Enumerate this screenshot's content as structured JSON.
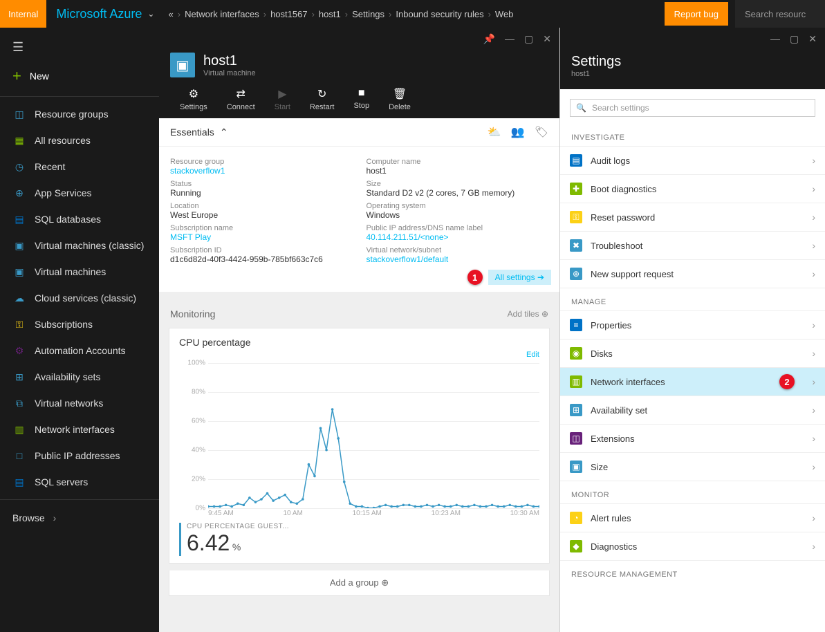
{
  "topbar": {
    "badge": "Internal",
    "brand": "Microsoft Azure",
    "breadcrumbs": [
      "«",
      "Network interfaces",
      "host1567",
      "host1",
      "Settings",
      "Inbound security rules",
      "Web"
    ],
    "report": "Report bug",
    "search_placeholder": "Search resourc"
  },
  "sidebar": {
    "new": "New",
    "items": [
      {
        "icon": "◫",
        "color": "#3999c6",
        "label": "Resource groups"
      },
      {
        "icon": "▦",
        "color": "#7fba00",
        "label": "All resources"
      },
      {
        "icon": "◷",
        "color": "#3999c6",
        "label": "Recent"
      },
      {
        "icon": "⊕",
        "color": "#3999c6",
        "label": "App Services"
      },
      {
        "icon": "▤",
        "color": "#0072c6",
        "label": "SQL databases"
      },
      {
        "icon": "▣",
        "color": "#3999c6",
        "label": "Virtual machines (classic)"
      },
      {
        "icon": "▣",
        "color": "#3999c6",
        "label": "Virtual machines"
      },
      {
        "icon": "☁",
        "color": "#3999c6",
        "label": "Cloud services (classic)"
      },
      {
        "icon": "⚿",
        "color": "#fcd116",
        "label": "Subscriptions"
      },
      {
        "icon": "⚙",
        "color": "#68217a",
        "label": "Automation Accounts"
      },
      {
        "icon": "⊞",
        "color": "#3999c6",
        "label": "Availability sets"
      },
      {
        "icon": "⧉",
        "color": "#3999c6",
        "label": "Virtual networks"
      },
      {
        "icon": "▥",
        "color": "#7fba00",
        "label": "Network interfaces"
      },
      {
        "icon": "□",
        "color": "#3999c6",
        "label": "Public IP addresses"
      },
      {
        "icon": "▤",
        "color": "#0072c6",
        "label": "SQL servers"
      }
    ],
    "browse": "Browse"
  },
  "vm": {
    "title": "host1",
    "subtitle": "Virtual machine",
    "toolbar": [
      {
        "icon": "⚙",
        "label": "Settings"
      },
      {
        "icon": "⇄",
        "label": "Connect"
      },
      {
        "icon": "▶",
        "label": "Start",
        "disabled": true
      },
      {
        "icon": "↻",
        "label": "Restart"
      },
      {
        "icon": "■",
        "label": "Stop"
      },
      {
        "icon": "🗑",
        "label": "Delete"
      }
    ],
    "essentials_title": "Essentials",
    "ess_left": [
      {
        "label": "Resource group",
        "value": "stackoverflow1",
        "link": true
      },
      {
        "label": "Status",
        "value": "Running"
      },
      {
        "label": "Location",
        "value": "West Europe"
      },
      {
        "label": "Subscription name",
        "value": "MSFT Play",
        "link": true
      },
      {
        "label": "Subscription ID",
        "value": "d1c6d82d-40f3-4424-959b-785bf663c7c6"
      }
    ],
    "ess_right": [
      {
        "label": "Computer name",
        "value": "host1"
      },
      {
        "label": "Size",
        "value": "Standard D2 v2 (2 cores, 7 GB memory)"
      },
      {
        "label": "Operating system",
        "value": "Windows"
      },
      {
        "label": "Public IP address/DNS name label",
        "value": "40.114.211.51/<none>",
        "link": true
      },
      {
        "label": "Virtual network/subnet",
        "value": "stackoverflow1/default",
        "link": true
      }
    ],
    "all_settings": "All settings",
    "callout1": "1",
    "monitoring": "Monitoring",
    "add_tiles": "Add tiles",
    "chart_title": "CPU percentage",
    "edit": "Edit",
    "cur_label": "CPU PERCENTAGE GUEST...",
    "cur_value": "6.42",
    "cur_unit": "%",
    "add_group": "Add a group"
  },
  "chart_data": {
    "type": "line",
    "yticks": [
      0,
      20,
      40,
      60,
      80,
      100
    ],
    "xticks": [
      "9:45 AM",
      "10 AM",
      "10:15 AM",
      "10:23 AM",
      "10:30 AM"
    ],
    "ylim": [
      0,
      100
    ],
    "series": [
      {
        "name": "CPU percentage guest",
        "color": "#3999c6",
        "values": [
          1,
          1,
          1,
          2,
          1,
          3,
          2,
          7,
          4,
          6,
          10,
          5,
          7,
          9,
          4,
          3,
          6,
          30,
          22,
          55,
          40,
          68,
          48,
          18,
          3,
          1,
          1,
          0,
          0,
          1,
          2,
          1,
          1,
          2,
          2,
          1,
          1,
          2,
          1,
          2,
          1,
          1,
          2,
          1,
          1,
          2,
          1,
          1,
          2,
          1,
          1,
          2,
          1,
          1,
          2,
          1,
          1
        ]
      }
    ]
  },
  "settings": {
    "title": "Settings",
    "sub": "host1",
    "search": "Search settings",
    "callout2": "2",
    "sections": [
      {
        "header": "INVESTIGATE",
        "items": [
          {
            "icon": "▤",
            "color": "#0072c6",
            "label": "Audit logs"
          },
          {
            "icon": "✚",
            "color": "#7fba00",
            "label": "Boot diagnostics"
          },
          {
            "icon": "⚿",
            "color": "#fcd116",
            "label": "Reset password"
          },
          {
            "icon": "✖",
            "color": "#3999c6",
            "label": "Troubleshoot"
          },
          {
            "icon": "⊕",
            "color": "#3999c6",
            "label": "New support request"
          }
        ]
      },
      {
        "header": "MANAGE",
        "items": [
          {
            "icon": "≡",
            "color": "#0072c6",
            "label": "Properties"
          },
          {
            "icon": "◉",
            "color": "#7fba00",
            "label": "Disks"
          },
          {
            "icon": "▥",
            "color": "#7fba00",
            "label": "Network interfaces",
            "selected": true,
            "callout": true
          },
          {
            "icon": "⊞",
            "color": "#3999c6",
            "label": "Availability set"
          },
          {
            "icon": "◫",
            "color": "#68217a",
            "label": "Extensions"
          },
          {
            "icon": "▣",
            "color": "#3999c6",
            "label": "Size"
          }
        ]
      },
      {
        "header": "MONITOR",
        "items": [
          {
            "icon": "◔",
            "color": "#fcd116",
            "label": "Alert rules"
          },
          {
            "icon": "◆",
            "color": "#7fba00",
            "label": "Diagnostics"
          }
        ]
      },
      {
        "header": "RESOURCE MANAGEMENT",
        "items": []
      }
    ]
  }
}
